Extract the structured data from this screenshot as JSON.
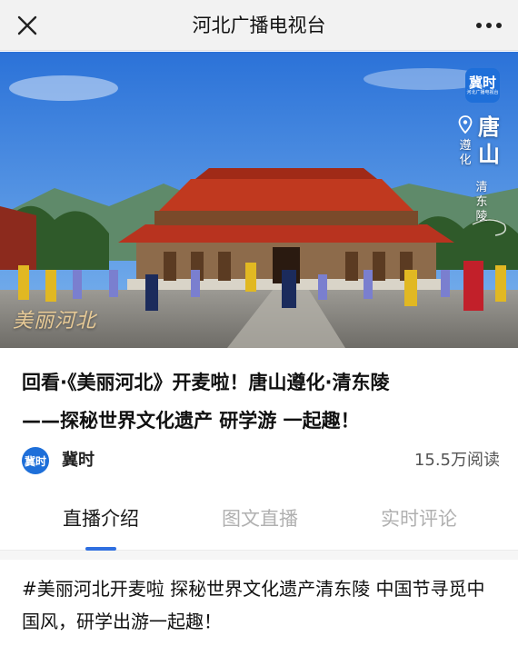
{
  "navbar": {
    "title": "河北广播电视台",
    "close_icon": "close-icon",
    "more_icon": "more-dots-icon"
  },
  "hero": {
    "logo_text": "冀时",
    "logo_subtext": "河北广播电视台",
    "location_city": "唐山",
    "location_sub1": "遵化",
    "location_sub2": "清东陵",
    "watermark": "美丽河北",
    "play_state": "video"
  },
  "article": {
    "title_line1": "回看·《美丽河北》开麦啦！唐山遵化·清东陵",
    "title_line2": "——探秘世界文化遗产 研学游 一起趣！",
    "author_avatar_text": "冀时",
    "author_name": "冀时",
    "read_count": "15.5万阅读"
  },
  "tabs": [
    {
      "label": "直播介绍",
      "active": true
    },
    {
      "label": "图文直播",
      "active": false
    },
    {
      "label": "实时评论",
      "active": false
    }
  ],
  "description": "#美丽河北开麦啦 探秘世界文化遗产清东陵 中国节寻觅中国风，研学出游一起趣！",
  "colors": {
    "accent": "#2f6fe0",
    "brand_logo": "#1e6fd9",
    "inactive_tab": "#b0b0b0"
  }
}
